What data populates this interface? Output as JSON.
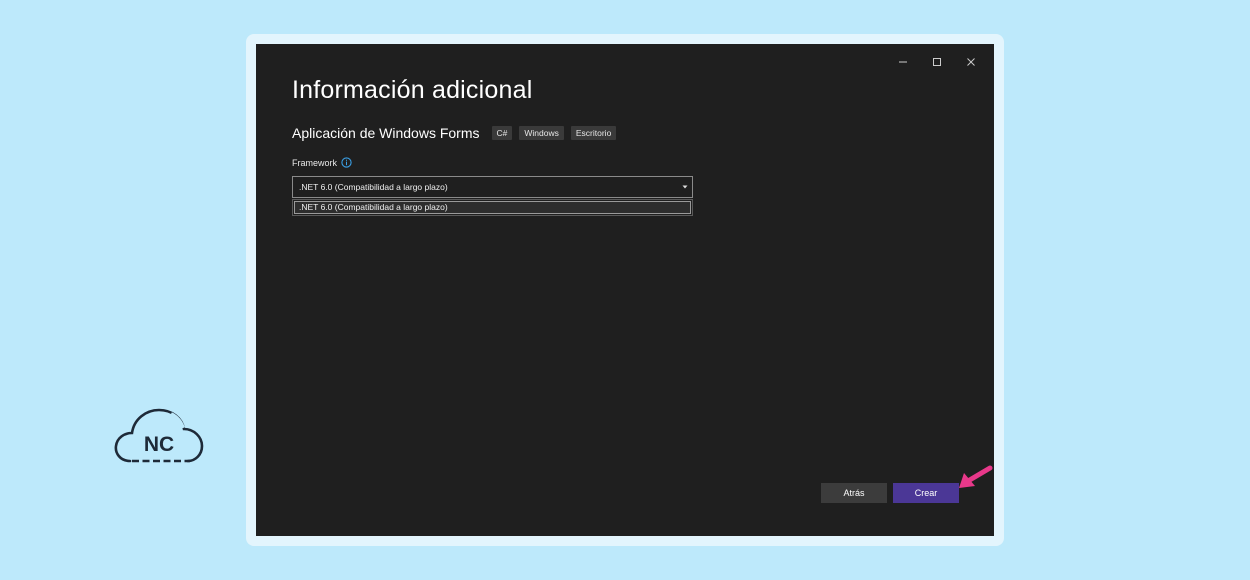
{
  "dialog": {
    "title": "Información adicional",
    "project_type": "Aplicación de Windows Forms",
    "tags": [
      "C#",
      "Windows",
      "Escritorio"
    ],
    "framework": {
      "label": "Framework",
      "selected": ".NET 6.0 (Compatibilidad a largo plazo)",
      "options": [
        ".NET 6.0 (Compatibilidad a largo plazo)"
      ]
    },
    "buttons": {
      "back": "Atrás",
      "create": "Crear"
    }
  },
  "logo": {
    "text": "NC"
  },
  "colors": {
    "background": "#bde9fb",
    "dialog": "#1f1f1f",
    "create_button": "#4b3796",
    "back_button": "#3c3c3c",
    "info_icon": "#3aa0e6",
    "arrow": "#e8388a"
  },
  "icons": [
    "minimize-icon",
    "maximize-icon",
    "close-icon",
    "info-icon",
    "chevron-down-icon",
    "pointer-arrow-icon",
    "nc-cloud-logo"
  ]
}
